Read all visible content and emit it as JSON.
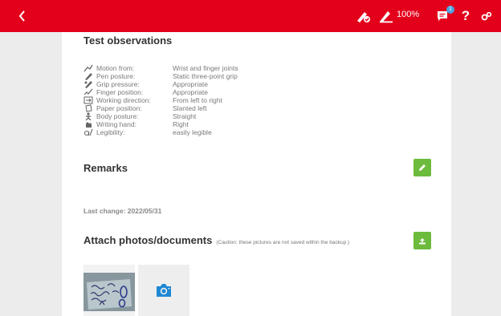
{
  "topbar": {
    "zoom": "100%",
    "notification_count": "1",
    "help": "?"
  },
  "observations": {
    "title": "Test observations",
    "rows": [
      {
        "icon": "motion-icon",
        "label": "Motion from:",
        "value": "Wrist and finger joints"
      },
      {
        "icon": "pen-posture-icon",
        "label": "Pen posture:",
        "value": "Static three-point grip"
      },
      {
        "icon": "grip-pressure-icon",
        "label": "Grip pressure:",
        "value": "Appropriate"
      },
      {
        "icon": "finger-position-icon",
        "label": "Finger position:",
        "value": "Appropriate"
      },
      {
        "icon": "working-direction-icon",
        "label": "Working direction:",
        "value": "From left to right"
      },
      {
        "icon": "paper-position-icon",
        "label": "Paper position:",
        "value": "Slanted left"
      },
      {
        "icon": "body-posture-icon",
        "label": "Body posture:",
        "value": "Straight"
      },
      {
        "icon": "writing-hand-icon",
        "label": "Writing hand:",
        "value": "Right"
      },
      {
        "icon": "legibility-icon",
        "label": "Legibility:",
        "value": "easily legible"
      }
    ]
  },
  "remarks": {
    "title": "Remarks"
  },
  "last_change": "Last change: 2022/05/31",
  "attach": {
    "title": "Attach photos/documents",
    "note": "(Caution: these pictures are not saved within the backup.)"
  },
  "colors": {
    "topbar": "#e3001b",
    "accent_green": "#6cbb3c",
    "camera_blue": "#1e88d4"
  }
}
